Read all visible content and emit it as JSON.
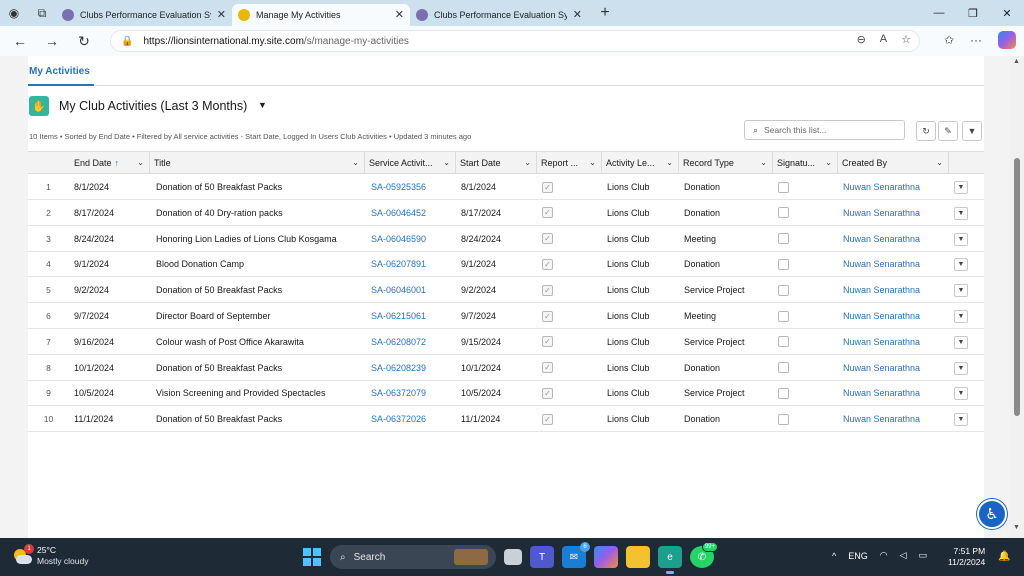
{
  "browser": {
    "tabs": [
      {
        "title": "Clubs Performance Evaluation Sys",
        "active": false
      },
      {
        "title": "Manage My Activities",
        "active": true
      },
      {
        "title": "Clubs Performance Evaluation Sys",
        "active": false
      }
    ],
    "url_host": "https://lionsinternational.my.site.com",
    "url_path": "/s/manage-my-activities"
  },
  "page": {
    "nav_tab": "My Activities",
    "list_title": "My Club Activities (Last 3 Months)",
    "meta": "10 Items • Sorted by End Date • Filtered by All service activities - Start Date, Logged In Users Club Activities • Updated 3 minutes ago",
    "search_placeholder": "Search this list..."
  },
  "table": {
    "columns": [
      "End Date",
      "Title",
      "Service Activit...",
      "Start Date",
      "Report ...",
      "Activity Le...",
      "Record Type",
      "Signatu...",
      "Created By"
    ],
    "rows": [
      {
        "num": "1",
        "end": "8/1/2024",
        "title": "Donation of 50 Breakfast Packs",
        "sa": "SA-05925356",
        "start": "8/1/2024",
        "level": "Lions Club",
        "type": "Donation",
        "by": "Nuwan Senarathna"
      },
      {
        "num": "2",
        "end": "8/17/2024",
        "title": "Donation of 40 Dry-ration packs",
        "sa": "SA-06046452",
        "start": "8/17/2024",
        "level": "Lions Club",
        "type": "Donation",
        "by": "Nuwan Senarathna"
      },
      {
        "num": "3",
        "end": "8/24/2024",
        "title": "Honoring Lion Ladies of Lions Club Kosgama",
        "sa": "SA-06046590",
        "start": "8/24/2024",
        "level": "Lions Club",
        "type": "Meeting",
        "by": "Nuwan Senarathna"
      },
      {
        "num": "4",
        "end": "9/1/2024",
        "title": "Blood Donation Camp",
        "sa": "SA-06207891",
        "start": "9/1/2024",
        "level": "Lions Club",
        "type": "Donation",
        "by": "Nuwan Senarathna"
      },
      {
        "num": "5",
        "end": "9/2/2024",
        "title": "Donation of 50 Breakfast Packs",
        "sa": "SA-06046001",
        "start": "9/2/2024",
        "level": "Lions Club",
        "type": "Service Project",
        "by": "Nuwan Senarathna"
      },
      {
        "num": "6",
        "end": "9/7/2024",
        "title": "Director Board of September",
        "sa": "SA-06215061",
        "start": "9/7/2024",
        "level": "Lions Club",
        "type": "Meeting",
        "by": "Nuwan Senarathna"
      },
      {
        "num": "7",
        "end": "9/16/2024",
        "title": "Colour wash of Post Office Akarawita",
        "sa": "SA-06208072",
        "start": "9/15/2024",
        "level": "Lions Club",
        "type": "Service Project",
        "by": "Nuwan Senarathna"
      },
      {
        "num": "8",
        "end": "10/1/2024",
        "title": "Donation of 50 Breakfast Packs",
        "sa": "SA-06208239",
        "start": "10/1/2024",
        "level": "Lions Club",
        "type": "Donation",
        "by": "Nuwan Senarathna"
      },
      {
        "num": "9",
        "end": "10/5/2024",
        "title": "Vision Screening and Provided Spectacles",
        "sa": "SA-06372079",
        "start": "10/5/2024",
        "level": "Lions Club",
        "type": "Service Project",
        "by": "Nuwan Senarathna"
      },
      {
        "num": "10",
        "end": "11/1/2024",
        "title": "Donation of 50 Breakfast Packs",
        "sa": "SA-06372026",
        "start": "11/1/2024",
        "level": "Lions Club",
        "type": "Donation",
        "by": "Nuwan Senarathna"
      }
    ]
  },
  "taskbar": {
    "temp": "25°C",
    "condition": "Mostly cloudy",
    "weather_badge": "1",
    "search_label": "Search",
    "mail_badge": "6",
    "whatsapp_badge": "99+",
    "lang": "ENG",
    "time": "7:51 PM",
    "date": "11/2/2024"
  }
}
